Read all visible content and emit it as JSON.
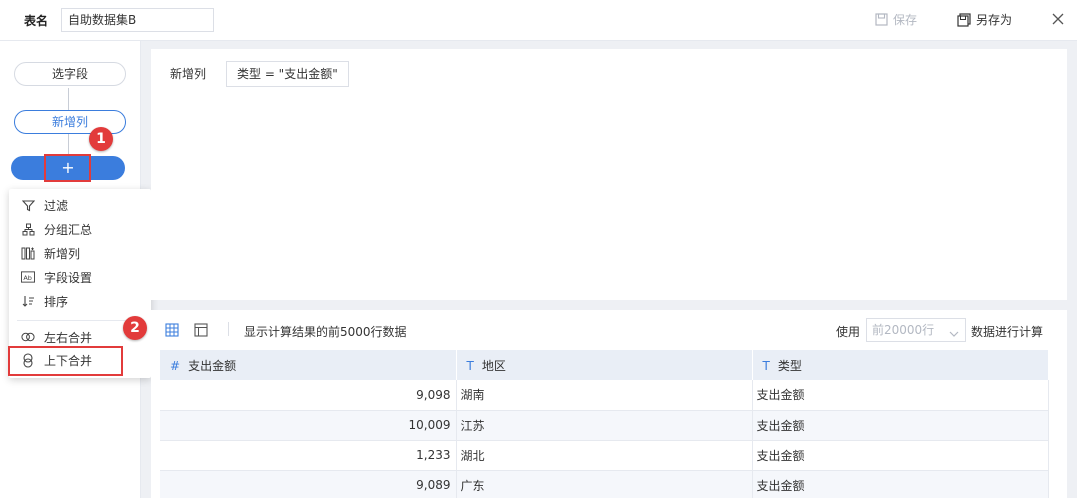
{
  "topbar": {
    "table_name_label": "表名",
    "table_name_value": "自助数据集B",
    "save_label": "保存",
    "saveas_label": "另存为"
  },
  "pipeline": {
    "nodes": [
      {
        "label": "选字段"
      },
      {
        "label": "新增列"
      }
    ],
    "add_label": "+"
  },
  "badges": {
    "one": "1",
    "two": "2"
  },
  "menu": {
    "items": [
      {
        "label": "过滤",
        "icon": "filter-icon"
      },
      {
        "label": "分组汇总",
        "icon": "group-summary-icon"
      },
      {
        "label": "新增列",
        "icon": "add-column-icon"
      },
      {
        "label": "字段设置",
        "icon": "field-settings-icon"
      },
      {
        "label": "排序",
        "icon": "sort-icon"
      },
      {
        "label": "左右合并",
        "icon": "merge-horizontal-icon"
      },
      {
        "label": "上下合并",
        "icon": "merge-vertical-icon"
      }
    ]
  },
  "formula": {
    "label": "新增列",
    "expression": "类型 = \"支出金额\""
  },
  "data_preview": {
    "info": "显示计算结果的前5000行数据",
    "use_label": "使用",
    "row_limit_value": "前20000行",
    "calc_label": "数据进行计算",
    "columns": [
      {
        "type_symbol": "#",
        "name": "支出金额"
      },
      {
        "type_symbol": "T",
        "name": "地区"
      },
      {
        "type_symbol": "T",
        "name": "类型"
      }
    ],
    "rows": [
      [
        "9,098",
        "湖南",
        "支出金额"
      ],
      [
        "10,009",
        "江苏",
        "支出金额"
      ],
      [
        "1,233",
        "湖北",
        "支出金额"
      ],
      [
        "9,089",
        "广东",
        "支出金额"
      ]
    ]
  },
  "colors": {
    "accent": "#3b7ddd",
    "highlight_red": "#e23b3b",
    "panel_bg": "#eef0f4",
    "table_header_bg": "#e9eef6"
  }
}
